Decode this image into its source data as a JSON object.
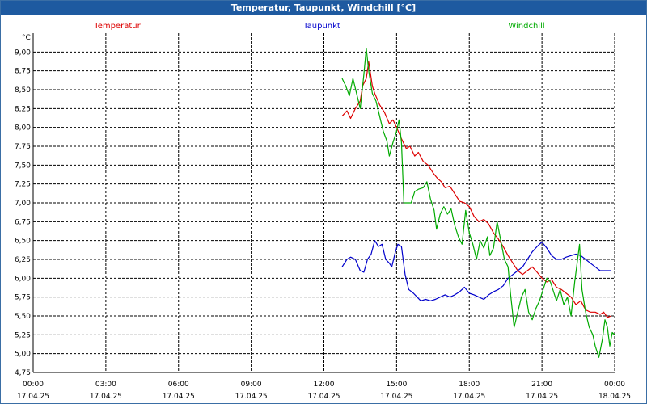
{
  "window": {
    "title": "Temperatur, Taupunkt, Windchill [°C]"
  },
  "chart_data": {
    "type": "line",
    "title": "Temperatur, Taupunkt, Windchill [°C]",
    "ylabel": "°C",
    "ylim": [
      4.75,
      9.25
    ],
    "y_ticks": [
      "4,75",
      "5,00",
      "5,25",
      "5,50",
      "5,75",
      "6,00",
      "6,25",
      "6,50",
      "6,75",
      "7,00",
      "7,25",
      "7,50",
      "7,75",
      "8,00",
      "8,25",
      "8,50",
      "8,75",
      "9,00"
    ],
    "xlim": [
      0,
      24
    ],
    "x_ticks": [
      {
        "time": "00:00",
        "date": "17.04.25"
      },
      {
        "time": "03:00",
        "date": "17.04.25"
      },
      {
        "time": "06:00",
        "date": "17.04.25"
      },
      {
        "time": "09:00",
        "date": "17.04.25"
      },
      {
        "time": "12:00",
        "date": "17.04.25"
      },
      {
        "time": "15:00",
        "date": "17.04.25"
      },
      {
        "time": "18:00",
        "date": "17.04.25"
      },
      {
        "time": "21:00",
        "date": "17.04.25"
      },
      {
        "time": "00:00",
        "date": "18.04.25"
      }
    ],
    "grid": true,
    "legend_placement": "top",
    "series": [
      {
        "name": "Temperatur",
        "color": "#dd0000",
        "points": [
          [
            12.75,
            8.15
          ],
          [
            12.95,
            8.22
          ],
          [
            13.1,
            8.12
          ],
          [
            13.3,
            8.25
          ],
          [
            13.5,
            8.35
          ],
          [
            13.6,
            8.55
          ],
          [
            13.75,
            8.65
          ],
          [
            13.85,
            8.87
          ],
          [
            14.0,
            8.55
          ],
          [
            14.1,
            8.45
          ],
          [
            14.3,
            8.3
          ],
          [
            14.5,
            8.2
          ],
          [
            14.7,
            8.05
          ],
          [
            14.85,
            8.1
          ],
          [
            15.0,
            8.0
          ],
          [
            15.2,
            7.85
          ],
          [
            15.4,
            7.72
          ],
          [
            15.55,
            7.75
          ],
          [
            15.75,
            7.62
          ],
          [
            15.9,
            7.67
          ],
          [
            16.1,
            7.55
          ],
          [
            16.3,
            7.5
          ],
          [
            16.5,
            7.4
          ],
          [
            16.7,
            7.32
          ],
          [
            16.85,
            7.28
          ],
          [
            17.0,
            7.2
          ],
          [
            17.2,
            7.22
          ],
          [
            17.4,
            7.12
          ],
          [
            17.6,
            7.02
          ],
          [
            17.8,
            7.0
          ],
          [
            18.0,
            6.95
          ],
          [
            18.2,
            6.82
          ],
          [
            18.4,
            6.75
          ],
          [
            18.6,
            6.78
          ],
          [
            18.8,
            6.72
          ],
          [
            19.0,
            6.6
          ],
          [
            19.2,
            6.52
          ],
          [
            19.4,
            6.42
          ],
          [
            19.6,
            6.3
          ],
          [
            19.8,
            6.2
          ],
          [
            20.0,
            6.1
          ],
          [
            20.2,
            6.05
          ],
          [
            20.4,
            6.1
          ],
          [
            20.6,
            6.15
          ],
          [
            20.8,
            6.08
          ],
          [
            21.0,
            6.0
          ],
          [
            21.2,
            5.95
          ],
          [
            21.4,
            5.98
          ],
          [
            21.6,
            5.88
          ],
          [
            21.8,
            5.85
          ],
          [
            22.0,
            5.8
          ],
          [
            22.2,
            5.75
          ],
          [
            22.4,
            5.65
          ],
          [
            22.6,
            5.7
          ],
          [
            22.8,
            5.58
          ],
          [
            23.0,
            5.55
          ],
          [
            23.2,
            5.55
          ],
          [
            23.4,
            5.52
          ],
          [
            23.55,
            5.55
          ],
          [
            23.7,
            5.48
          ],
          [
            23.85,
            5.5
          ]
        ]
      },
      {
        "name": "Taupunkt",
        "color": "#0000cc",
        "points": [
          [
            12.75,
            6.15
          ],
          [
            12.95,
            6.25
          ],
          [
            13.1,
            6.28
          ],
          [
            13.3,
            6.25
          ],
          [
            13.5,
            6.1
          ],
          [
            13.65,
            6.08
          ],
          [
            13.8,
            6.25
          ],
          [
            13.95,
            6.32
          ],
          [
            14.1,
            6.5
          ],
          [
            14.25,
            6.42
          ],
          [
            14.4,
            6.45
          ],
          [
            14.55,
            6.25
          ],
          [
            14.7,
            6.2
          ],
          [
            14.8,
            6.15
          ],
          [
            14.95,
            6.35
          ],
          [
            15.05,
            6.45
          ],
          [
            15.2,
            6.42
          ],
          [
            15.35,
            6.05
          ],
          [
            15.5,
            5.85
          ],
          [
            15.7,
            5.8
          ],
          [
            15.85,
            5.75
          ],
          [
            16.0,
            5.7
          ],
          [
            16.2,
            5.72
          ],
          [
            16.4,
            5.7
          ],
          [
            16.6,
            5.72
          ],
          [
            16.8,
            5.75
          ],
          [
            17.0,
            5.78
          ],
          [
            17.2,
            5.75
          ],
          [
            17.4,
            5.78
          ],
          [
            17.6,
            5.82
          ],
          [
            17.8,
            5.88
          ],
          [
            18.0,
            5.8
          ],
          [
            18.2,
            5.78
          ],
          [
            18.4,
            5.75
          ],
          [
            18.6,
            5.72
          ],
          [
            18.8,
            5.78
          ],
          [
            19.0,
            5.82
          ],
          [
            19.2,
            5.85
          ],
          [
            19.4,
            5.9
          ],
          [
            19.6,
            6.0
          ],
          [
            19.8,
            6.05
          ],
          [
            20.0,
            6.1
          ],
          [
            20.2,
            6.15
          ],
          [
            20.4,
            6.25
          ],
          [
            20.6,
            6.35
          ],
          [
            20.8,
            6.42
          ],
          [
            21.0,
            6.48
          ],
          [
            21.2,
            6.4
          ],
          [
            21.4,
            6.3
          ],
          [
            21.6,
            6.25
          ],
          [
            21.8,
            6.25
          ],
          [
            22.0,
            6.28
          ],
          [
            22.2,
            6.3
          ],
          [
            22.4,
            6.32
          ],
          [
            22.6,
            6.3
          ],
          [
            22.8,
            6.25
          ],
          [
            23.0,
            6.2
          ],
          [
            23.2,
            6.15
          ],
          [
            23.4,
            6.1
          ],
          [
            23.6,
            6.1
          ],
          [
            23.85,
            6.1
          ]
        ]
      },
      {
        "name": "Windchill",
        "color": "#00aa00",
        "points": [
          [
            12.75,
            8.65
          ],
          [
            12.9,
            8.55
          ],
          [
            13.05,
            8.42
          ],
          [
            13.2,
            8.65
          ],
          [
            13.35,
            8.45
          ],
          [
            13.5,
            8.25
          ],
          [
            13.65,
            8.7
          ],
          [
            13.75,
            9.05
          ],
          [
            13.85,
            8.75
          ],
          [
            14.0,
            8.45
          ],
          [
            14.15,
            8.35
          ],
          [
            14.3,
            8.15
          ],
          [
            14.45,
            7.95
          ],
          [
            14.6,
            7.82
          ],
          [
            14.7,
            7.62
          ],
          [
            14.85,
            7.8
          ],
          [
            15.0,
            7.95
          ],
          [
            15.1,
            8.1
          ],
          [
            15.2,
            7.8
          ],
          [
            15.3,
            7.0
          ],
          [
            15.45,
            7.0
          ],
          [
            15.6,
            7.0
          ],
          [
            15.75,
            7.15
          ],
          [
            15.9,
            7.18
          ],
          [
            16.1,
            7.2
          ],
          [
            16.25,
            7.28
          ],
          [
            16.4,
            7.05
          ],
          [
            16.55,
            6.9
          ],
          [
            16.65,
            6.65
          ],
          [
            16.8,
            6.85
          ],
          [
            16.95,
            6.95
          ],
          [
            17.1,
            6.85
          ],
          [
            17.25,
            6.92
          ],
          [
            17.4,
            6.7
          ],
          [
            17.55,
            6.55
          ],
          [
            17.7,
            6.45
          ],
          [
            17.85,
            6.9
          ],
          [
            18.0,
            6.6
          ],
          [
            18.15,
            6.45
          ],
          [
            18.3,
            6.25
          ],
          [
            18.45,
            6.5
          ],
          [
            18.6,
            6.4
          ],
          [
            18.75,
            6.55
          ],
          [
            18.85,
            6.3
          ],
          [
            19.0,
            6.4
          ],
          [
            19.15,
            6.75
          ],
          [
            19.3,
            6.5
          ],
          [
            19.45,
            6.25
          ],
          [
            19.6,
            6.15
          ],
          [
            19.7,
            5.8
          ],
          [
            19.85,
            5.35
          ],
          [
            20.0,
            5.55
          ],
          [
            20.15,
            5.75
          ],
          [
            20.3,
            5.85
          ],
          [
            20.45,
            5.55
          ],
          [
            20.6,
            5.45
          ],
          [
            20.75,
            5.6
          ],
          [
            20.9,
            5.7
          ],
          [
            21.05,
            5.85
          ],
          [
            21.2,
            6.0
          ],
          [
            21.35,
            5.95
          ],
          [
            21.5,
            5.8
          ],
          [
            21.6,
            5.7
          ],
          [
            21.75,
            5.85
          ],
          [
            21.9,
            5.65
          ],
          [
            22.05,
            5.75
          ],
          [
            22.2,
            5.5
          ],
          [
            22.35,
            5.95
          ],
          [
            22.45,
            6.2
          ],
          [
            22.55,
            6.45
          ],
          [
            22.65,
            5.85
          ],
          [
            22.8,
            5.55
          ],
          [
            22.95,
            5.35
          ],
          [
            23.1,
            5.25
          ],
          [
            23.2,
            5.1
          ],
          [
            23.35,
            4.95
          ],
          [
            23.5,
            5.2
          ],
          [
            23.6,
            5.45
          ],
          [
            23.7,
            5.35
          ],
          [
            23.8,
            5.1
          ],
          [
            23.9,
            5.28
          ],
          [
            24.0,
            5.25
          ]
        ]
      }
    ]
  }
}
